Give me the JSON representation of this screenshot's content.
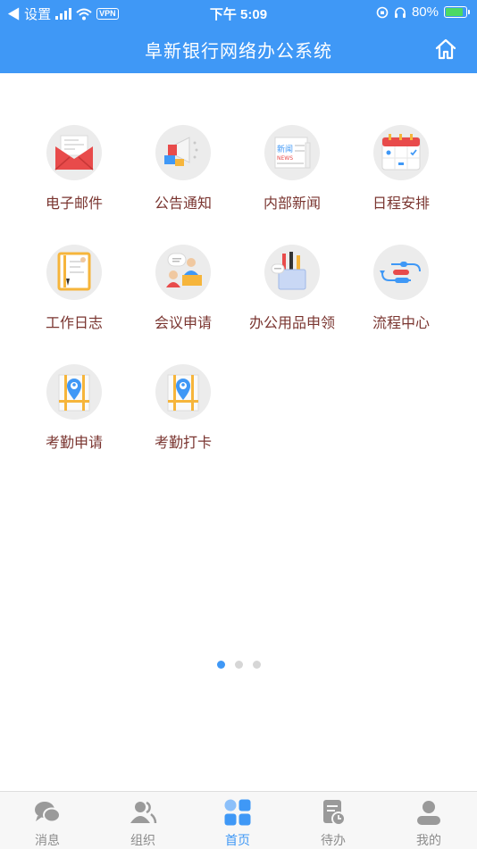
{
  "status_bar": {
    "back_label": "◀ 设置",
    "time": "下午 5:09",
    "vpn": "VPN",
    "battery": "80%",
    "battery_level": 0.8
  },
  "header": {
    "title": "阜新银行网络办公系统",
    "home_icon": "home-icon"
  },
  "apps": [
    {
      "label": "电子邮件",
      "icon": "envelope-icon"
    },
    {
      "label": "公告通知",
      "icon": "megaphone-icon"
    },
    {
      "label": "内部新闻",
      "icon": "newspaper-icon"
    },
    {
      "label": "日程安排",
      "icon": "calendar-icon"
    },
    {
      "label": "工作日志",
      "icon": "notebook-icon"
    },
    {
      "label": "会议申请",
      "icon": "meeting-icon"
    },
    {
      "label": "办公用品申领",
      "icon": "pen-holder-icon"
    },
    {
      "label": "流程中心",
      "icon": "flow-icon"
    },
    {
      "label": "考勤申请",
      "icon": "map-pin-icon"
    },
    {
      "label": "考勤打卡",
      "icon": "map-pin-icon"
    }
  ],
  "pager": {
    "pages": 3,
    "current": 1
  },
  "tabs": [
    {
      "label": "消息",
      "icon": "chat-icon",
      "active": false
    },
    {
      "label": "组织",
      "icon": "contacts-icon",
      "active": false
    },
    {
      "label": "首页",
      "icon": "grid-icon",
      "active": true
    },
    {
      "label": "待办",
      "icon": "todo-icon",
      "active": false
    },
    {
      "label": "我的",
      "icon": "user-icon",
      "active": false
    }
  ],
  "colors": {
    "primary": "#3f98f6",
    "label": "#7a3530",
    "tab_inactive": "#8c8c8c",
    "icon_bg": "#ececec"
  }
}
